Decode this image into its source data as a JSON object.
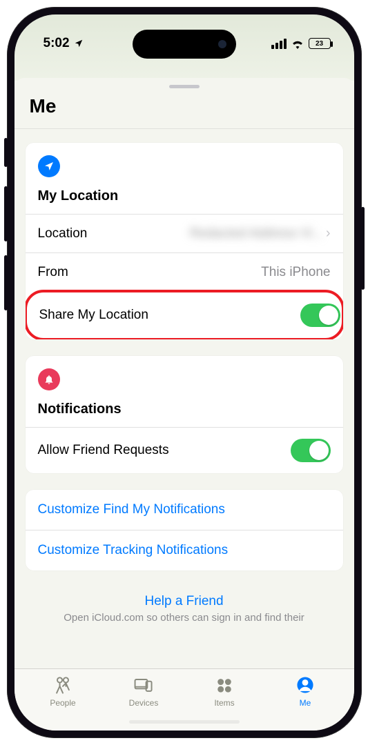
{
  "status": {
    "time": "5:02",
    "battery": "23"
  },
  "sheet": {
    "title": "Me"
  },
  "location_section": {
    "title": "My Location",
    "rows": {
      "location_label": "Location",
      "location_value": "Redacted Address Vi...",
      "from_label": "From",
      "from_value": "This iPhone",
      "share_label": "Share My Location"
    }
  },
  "notifications_section": {
    "title": "Notifications",
    "allow_label": "Allow Friend Requests",
    "links": {
      "customize_findmy": "Customize Find My Notifications",
      "customize_tracking": "Customize Tracking Notifications"
    }
  },
  "help": {
    "link": "Help a Friend",
    "subtitle": "Open iCloud.com so others can sign in and find their"
  },
  "tabs": {
    "people": "People",
    "devices": "Devices",
    "items": "Items",
    "me": "Me"
  }
}
